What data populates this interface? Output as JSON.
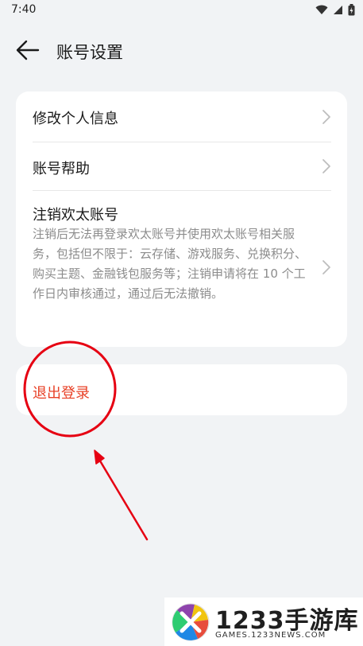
{
  "status_bar": {
    "time": "7:40"
  },
  "header": {
    "title": "账号设置"
  },
  "settings": {
    "items": [
      {
        "label": "修改个人信息"
      },
      {
        "label": "账号帮助"
      },
      {
        "label": "注销欢太账号",
        "description": "注销后无法再登录欢太账号并使用欢太账号相关服务，包括但不限于：云存储、游戏服务、兑换积分、购买主题、金融钱包服务等；注销申请将在 10 个工作日内审核通过，通过后无法撤销。"
      }
    ]
  },
  "logout": {
    "label": "退出登录"
  },
  "colors": {
    "accent_red": "#e84026",
    "annotation_red": "#e60012"
  },
  "watermark": {
    "brand": "1233手游库",
    "url": "GAMES.1233NEWS.COM"
  }
}
